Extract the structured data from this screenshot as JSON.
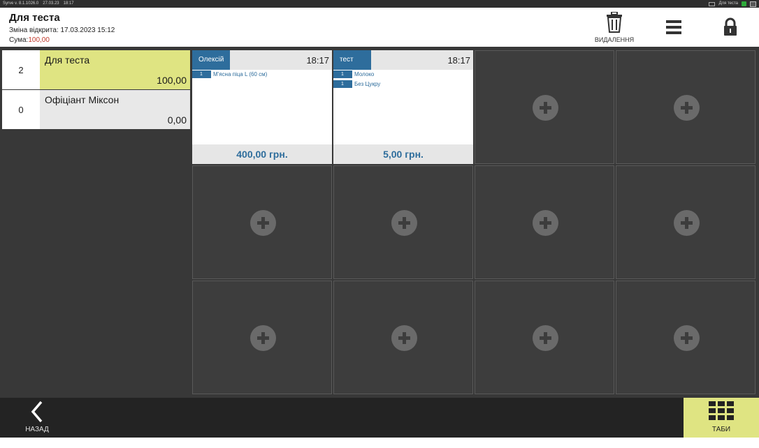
{
  "os_bar": {
    "left_items": [
      "Syrve v. 8.1.1026.0",
      "27.03.23",
      "18:17"
    ],
    "right_label": "Для теста"
  },
  "header": {
    "title": "Для теста",
    "shift_text": "Зміна відкрита: 17.03.2023 15:12",
    "sum_label": "Сума:",
    "sum_value": "100,00",
    "delete_label": "ВИДАЛЕННЯ"
  },
  "tab_list": [
    {
      "count": "2",
      "name": "Для теста",
      "amount": "100,00",
      "active": true
    },
    {
      "count": "0",
      "name": "Офіціант Міксон",
      "amount": "0,00",
      "active": false
    }
  ],
  "orders": [
    {
      "waiter": "Олексій",
      "time": "18:17",
      "items": [
        {
          "qty": "1",
          "name": "М'ясна піца L (60 см)"
        }
      ],
      "total": "400,00 грн."
    },
    {
      "waiter": "тест",
      "time": "18:17",
      "items": [
        {
          "qty": "1",
          "name": "Молоко"
        },
        {
          "qty": "1",
          "name": "Без Цукру"
        }
      ],
      "total": "5,00 грн."
    }
  ],
  "bottom_bar": {
    "back_label": "НАЗАД",
    "tabs_label": "ТАБИ"
  },
  "icons": {
    "delete": "trash-icon",
    "menu": "hamburger-menu-icon",
    "lock": "lock-icon",
    "back": "chevron-left-icon",
    "tabs": "grid-icon",
    "add": "plus-circle-icon"
  },
  "colors": {
    "accent_yellow": "#dfe482",
    "waiter_blue": "#2e6d9c",
    "sum_red": "#c0392b",
    "grid_bg": "#383838"
  }
}
